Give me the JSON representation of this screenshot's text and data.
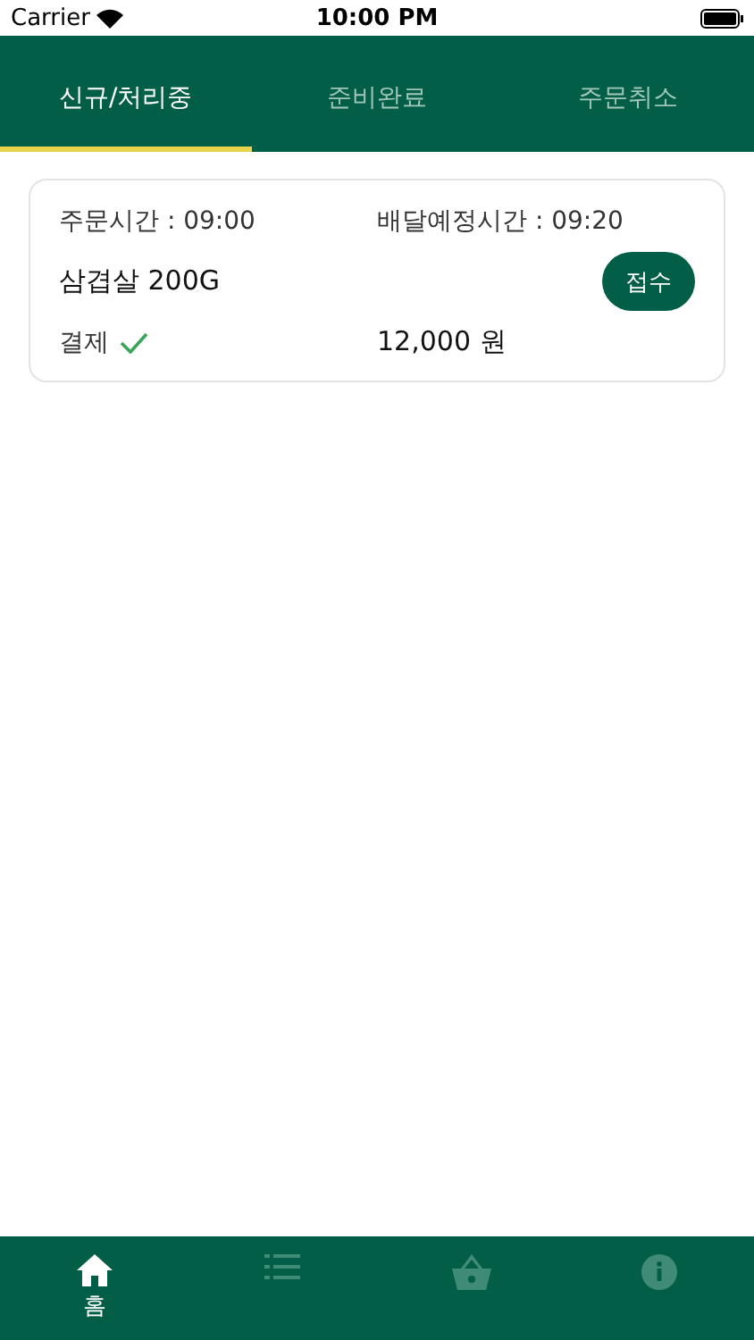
{
  "status_bar": {
    "carrier": "Carrier",
    "time": "10:00 PM"
  },
  "tabs": [
    {
      "label": "신규/처리중",
      "selected": true
    },
    {
      "label": "준비완료",
      "selected": false
    },
    {
      "label": "주문취소",
      "selected": false
    }
  ],
  "orders": [
    {
      "order_time": "주문시간 : 09:00",
      "delivery_time": "배달예정시간 : 09:20",
      "item": "삼겹살 200G",
      "action": "접수",
      "payment_label": "결제",
      "paid": true,
      "price": "12,000 원"
    }
  ],
  "bottom_nav": [
    {
      "kind": "home",
      "label": "홈",
      "selected": true
    },
    {
      "kind": "list",
      "selected": false
    },
    {
      "kind": "basket",
      "selected": false
    },
    {
      "kind": "info",
      "selected": false
    }
  ]
}
